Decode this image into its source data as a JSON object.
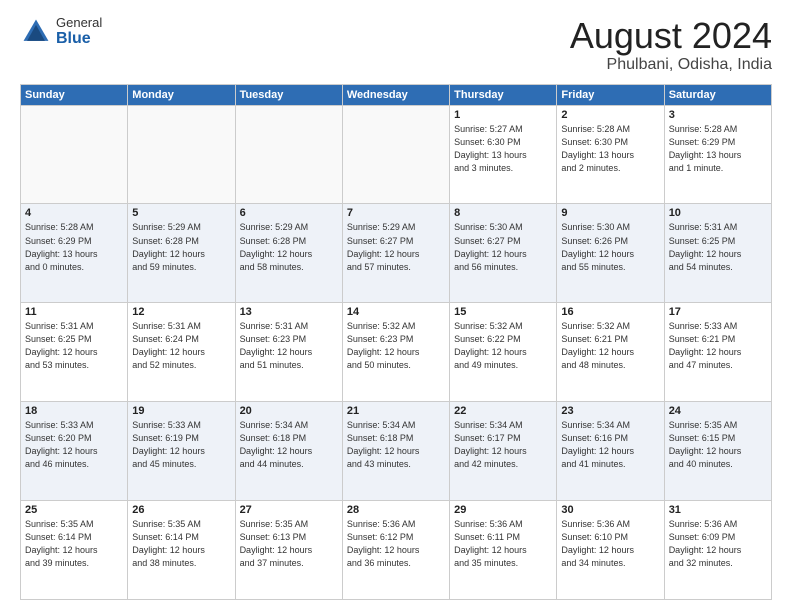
{
  "logo": {
    "general": "General",
    "blue": "Blue"
  },
  "header": {
    "month": "August 2024",
    "location": "Phulbani, Odisha, India"
  },
  "days_of_week": [
    "Sunday",
    "Monday",
    "Tuesday",
    "Wednesday",
    "Thursday",
    "Friday",
    "Saturday"
  ],
  "weeks": [
    [
      {
        "day": "",
        "info": ""
      },
      {
        "day": "",
        "info": ""
      },
      {
        "day": "",
        "info": ""
      },
      {
        "day": "",
        "info": ""
      },
      {
        "day": "1",
        "info": "Sunrise: 5:27 AM\nSunset: 6:30 PM\nDaylight: 13 hours\nand 3 minutes."
      },
      {
        "day": "2",
        "info": "Sunrise: 5:28 AM\nSunset: 6:30 PM\nDaylight: 13 hours\nand 2 minutes."
      },
      {
        "day": "3",
        "info": "Sunrise: 5:28 AM\nSunset: 6:29 PM\nDaylight: 13 hours\nand 1 minute."
      }
    ],
    [
      {
        "day": "4",
        "info": "Sunrise: 5:28 AM\nSunset: 6:29 PM\nDaylight: 13 hours\nand 0 minutes."
      },
      {
        "day": "5",
        "info": "Sunrise: 5:29 AM\nSunset: 6:28 PM\nDaylight: 12 hours\nand 59 minutes."
      },
      {
        "day": "6",
        "info": "Sunrise: 5:29 AM\nSunset: 6:28 PM\nDaylight: 12 hours\nand 58 minutes."
      },
      {
        "day": "7",
        "info": "Sunrise: 5:29 AM\nSunset: 6:27 PM\nDaylight: 12 hours\nand 57 minutes."
      },
      {
        "day": "8",
        "info": "Sunrise: 5:30 AM\nSunset: 6:27 PM\nDaylight: 12 hours\nand 56 minutes."
      },
      {
        "day": "9",
        "info": "Sunrise: 5:30 AM\nSunset: 6:26 PM\nDaylight: 12 hours\nand 55 minutes."
      },
      {
        "day": "10",
        "info": "Sunrise: 5:31 AM\nSunset: 6:25 PM\nDaylight: 12 hours\nand 54 minutes."
      }
    ],
    [
      {
        "day": "11",
        "info": "Sunrise: 5:31 AM\nSunset: 6:25 PM\nDaylight: 12 hours\nand 53 minutes."
      },
      {
        "day": "12",
        "info": "Sunrise: 5:31 AM\nSunset: 6:24 PM\nDaylight: 12 hours\nand 52 minutes."
      },
      {
        "day": "13",
        "info": "Sunrise: 5:31 AM\nSunset: 6:23 PM\nDaylight: 12 hours\nand 51 minutes."
      },
      {
        "day": "14",
        "info": "Sunrise: 5:32 AM\nSunset: 6:23 PM\nDaylight: 12 hours\nand 50 minutes."
      },
      {
        "day": "15",
        "info": "Sunrise: 5:32 AM\nSunset: 6:22 PM\nDaylight: 12 hours\nand 49 minutes."
      },
      {
        "day": "16",
        "info": "Sunrise: 5:32 AM\nSunset: 6:21 PM\nDaylight: 12 hours\nand 48 minutes."
      },
      {
        "day": "17",
        "info": "Sunrise: 5:33 AM\nSunset: 6:21 PM\nDaylight: 12 hours\nand 47 minutes."
      }
    ],
    [
      {
        "day": "18",
        "info": "Sunrise: 5:33 AM\nSunset: 6:20 PM\nDaylight: 12 hours\nand 46 minutes."
      },
      {
        "day": "19",
        "info": "Sunrise: 5:33 AM\nSunset: 6:19 PM\nDaylight: 12 hours\nand 45 minutes."
      },
      {
        "day": "20",
        "info": "Sunrise: 5:34 AM\nSunset: 6:18 PM\nDaylight: 12 hours\nand 44 minutes."
      },
      {
        "day": "21",
        "info": "Sunrise: 5:34 AM\nSunset: 6:18 PM\nDaylight: 12 hours\nand 43 minutes."
      },
      {
        "day": "22",
        "info": "Sunrise: 5:34 AM\nSunset: 6:17 PM\nDaylight: 12 hours\nand 42 minutes."
      },
      {
        "day": "23",
        "info": "Sunrise: 5:34 AM\nSunset: 6:16 PM\nDaylight: 12 hours\nand 41 minutes."
      },
      {
        "day": "24",
        "info": "Sunrise: 5:35 AM\nSunset: 6:15 PM\nDaylight: 12 hours\nand 40 minutes."
      }
    ],
    [
      {
        "day": "25",
        "info": "Sunrise: 5:35 AM\nSunset: 6:14 PM\nDaylight: 12 hours\nand 39 minutes."
      },
      {
        "day": "26",
        "info": "Sunrise: 5:35 AM\nSunset: 6:14 PM\nDaylight: 12 hours\nand 38 minutes."
      },
      {
        "day": "27",
        "info": "Sunrise: 5:35 AM\nSunset: 6:13 PM\nDaylight: 12 hours\nand 37 minutes."
      },
      {
        "day": "28",
        "info": "Sunrise: 5:36 AM\nSunset: 6:12 PM\nDaylight: 12 hours\nand 36 minutes."
      },
      {
        "day": "29",
        "info": "Sunrise: 5:36 AM\nSunset: 6:11 PM\nDaylight: 12 hours\nand 35 minutes."
      },
      {
        "day": "30",
        "info": "Sunrise: 5:36 AM\nSunset: 6:10 PM\nDaylight: 12 hours\nand 34 minutes."
      },
      {
        "day": "31",
        "info": "Sunrise: 5:36 AM\nSunset: 6:09 PM\nDaylight: 12 hours\nand 32 minutes."
      }
    ]
  ]
}
